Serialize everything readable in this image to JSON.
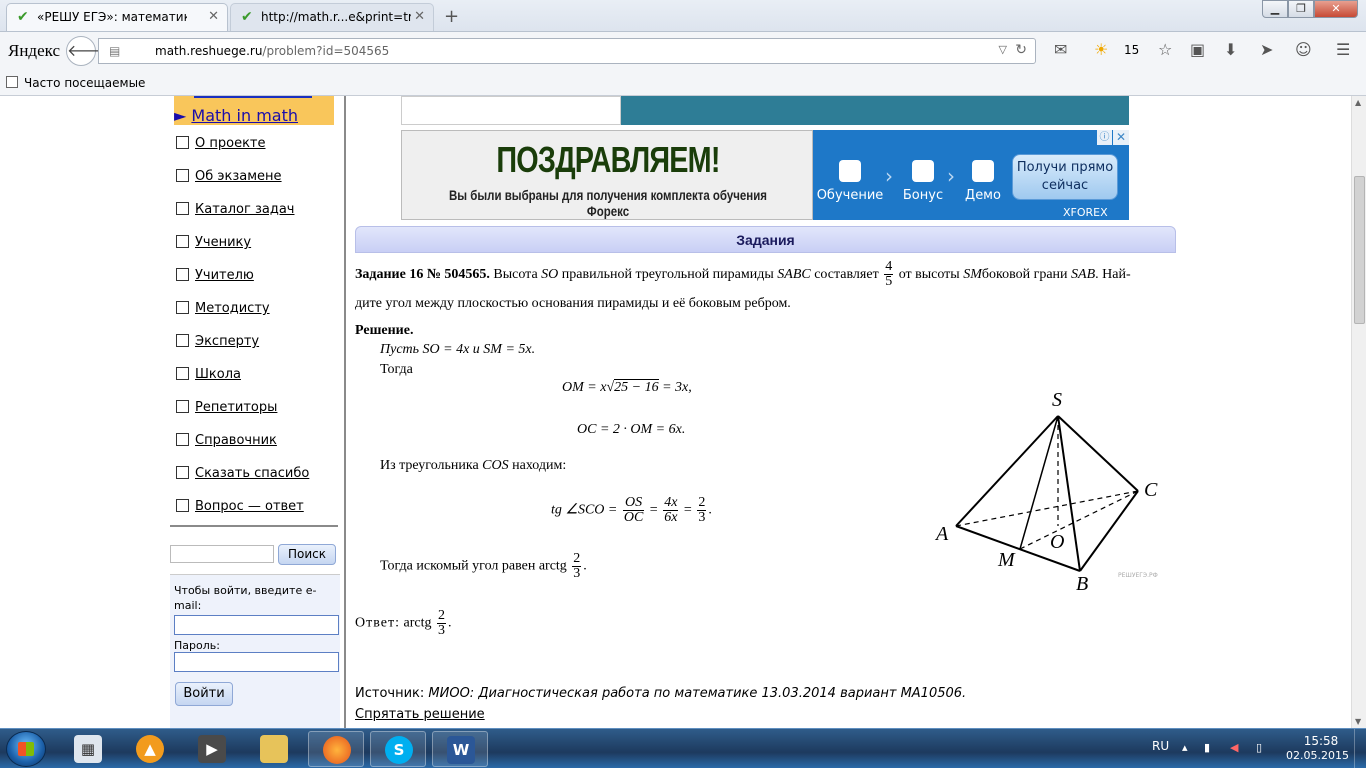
{
  "browser": {
    "tabs": [
      {
        "title": "«РЕШУ ЕГЭ»: математика. ...",
        "active": true
      },
      {
        "title": "http://math.r...e&print=true",
        "active": false
      }
    ],
    "brand": "Яндекс",
    "url_domain": "math.reshuege.ru",
    "url_path": "/problem?id=504565",
    "weather_temp": "15",
    "bookmarks_label": "Часто посещаемые",
    "new_tab": "+",
    "close_glyph": "✕"
  },
  "sidebar": {
    "highlight_link": "Math in math",
    "highlight_marker": "►",
    "menu": [
      "О проекте",
      "Об экзамене",
      "Каталог задач",
      "Ученику",
      "Учителю",
      "Методисту",
      "Эксперту",
      "Школа",
      "Репетиторы",
      "Справочник",
      "Сказать спасибо",
      "Вопрос — ответ"
    ],
    "search_button": "Поиск",
    "login_note": "Чтобы войти, введите e-mail:",
    "password_label": "Пароль:",
    "login_button": "Войти"
  },
  "ad": {
    "headline": "ПОЗДРАВЛЯЕМ!",
    "subline": "Вы были выбраны для получения комплекта обучения Форекс",
    "steps": [
      "Обучение",
      "Бонус",
      "Демо"
    ],
    "cta": "Получи прямо сейчас",
    "brand": "XFOREX",
    "info": "ⓘ",
    "close": "✕"
  },
  "content": {
    "section_title": "Задания",
    "task_label": "Задание 16 № 504565.",
    "task_text_1": "Высота",
    "task_so": "SO",
    "task_text_2": "правильной треугольной пирамиды",
    "task_sabc": "SABC",
    "task_text_3": "составляет",
    "frac_num": "4",
    "frac_den": "5",
    "task_text_4": "от высоты",
    "task_sm": "SM",
    "task_text_5": "боковой грани",
    "task_sab": "SAB",
    "task_text_6": ". Най-",
    "task_line2": "дите угол между плоскостью основания пирамиды и её боковым ребром.",
    "solution_title": "Решение.",
    "sol_line1": "Пусть SO = 4x и SM = 5x.",
    "sol_line2": "Тогда",
    "eq_om_left": "OM = x",
    "eq_om_sqrt": "25 − 16",
    "eq_om_right": " = 3x,",
    "eq_oc": "OC = 2 · OM = 6x.",
    "sol_line3_a": "Из треугольника",
    "sol_line3_b": "COS",
    "sol_line3_c": "находим:",
    "eq_tg_left": "tg ∠SCO =",
    "eq_tg_f1_num": "OS",
    "eq_tg_f1_den": "OC",
    "eq_tg_f2_num": "4x",
    "eq_tg_f2_den": "6x",
    "eq_tg_f3_num": "2",
    "eq_tg_f3_den": "3",
    "eq_eq": "=",
    "sol_line4": "Тогда искомый угол равен arctg",
    "ans_num": "2",
    "ans_den": "3",
    "period": ".",
    "answer_label": "Ответ:",
    "answer_text": "arctg",
    "source_label": "Источник:",
    "source_text": "МИОО: Диагностическая работа по математике 13.03.2014 вариант MA10506.",
    "hide_solution": "Спрятать решение",
    "figure_labels": {
      "S": "S",
      "A": "A",
      "B": "B",
      "C": "C",
      "M": "M",
      "O": "O"
    },
    "figure_watermark": "РЕШУЕГЭ.РФ"
  },
  "taskbar": {
    "language": "RU",
    "time": "15:58",
    "date": "02.05.2015",
    "apps": [
      "calculator",
      "avast",
      "media-player",
      "explorer",
      "firefox",
      "skype",
      "word"
    ]
  }
}
